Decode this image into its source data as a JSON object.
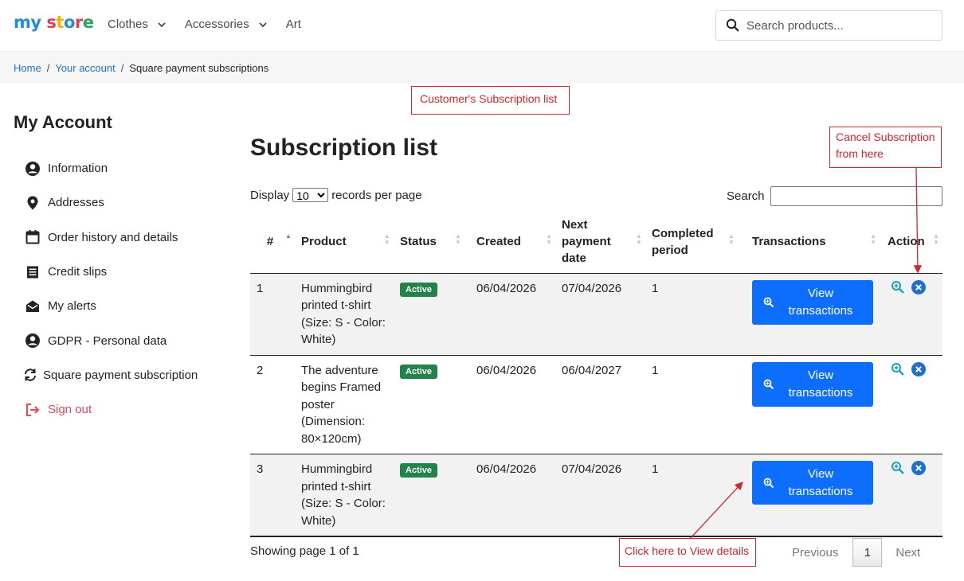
{
  "header": {
    "logo": {
      "my": "my",
      "store": "store"
    },
    "nav": [
      {
        "label": "Clothes",
        "has_dropdown": true
      },
      {
        "label": "Accessories",
        "has_dropdown": true
      },
      {
        "label": "Art",
        "has_dropdown": false
      }
    ],
    "search_placeholder": "Search products..."
  },
  "breadcrumb": [
    {
      "label": "Home",
      "link": true
    },
    {
      "label": "Your account",
      "link": true
    },
    {
      "label": "Square payment subscriptions",
      "link": false
    }
  ],
  "sidebar": {
    "title": "My Account",
    "items": [
      {
        "label": "Information",
        "icon": "user-circle-icon"
      },
      {
        "label": "Addresses",
        "icon": "location-pin-icon"
      },
      {
        "label": "Order history and details",
        "icon": "calendar-icon"
      },
      {
        "label": "Credit slips",
        "icon": "document-icon"
      },
      {
        "label": "My alerts",
        "icon": "envelope-open-icon"
      },
      {
        "label": "GDPR - Personal data",
        "icon": "user-circle-icon"
      },
      {
        "label": "Square payment subscription",
        "icon": "sync-icon"
      },
      {
        "label": "Sign out",
        "icon": "sign-out-icon"
      }
    ]
  },
  "main": {
    "title": "Subscription list",
    "display_prefix": "Display",
    "display_value": "10",
    "display_suffix": "records per page",
    "search_label": "Search",
    "columns": [
      "#",
      "Product",
      "Status",
      "Created",
      "Next payment date",
      "Completed period",
      "Transactions",
      "Action"
    ],
    "rows": [
      {
        "num": "1",
        "product": "Hummingbird printed t-shirt (Size: S - Color: White)",
        "status": "Active",
        "created": "06/04/2026",
        "next": "07/04/2026",
        "completed": "1",
        "transactions": "View transactions"
      },
      {
        "num": "2",
        "product": "The adventure begins Framed poster (Dimension: 80×120cm)",
        "status": "Active",
        "created": "06/04/2026",
        "next": "06/04/2027",
        "completed": "1",
        "transactions": "View transactions"
      },
      {
        "num": "3",
        "product": "Hummingbird printed t-shirt (Size: S - Color: White)",
        "status": "Active",
        "created": "06/04/2026",
        "next": "07/04/2026",
        "completed": "1",
        "transactions": "View transactions"
      }
    ],
    "showing": "Showing page 1 of 1",
    "pager": {
      "prev": "Previous",
      "page": "1",
      "next": "Next"
    }
  },
  "annotations": {
    "list": "Customer's Subscription list",
    "cancel": "Cancel Subscription from here",
    "view": "Click here to View details"
  },
  "colors": {
    "accent": "#0d6efd",
    "status_active": "#21834a",
    "annotation": "#d0262d",
    "signout": "#e8445a"
  }
}
